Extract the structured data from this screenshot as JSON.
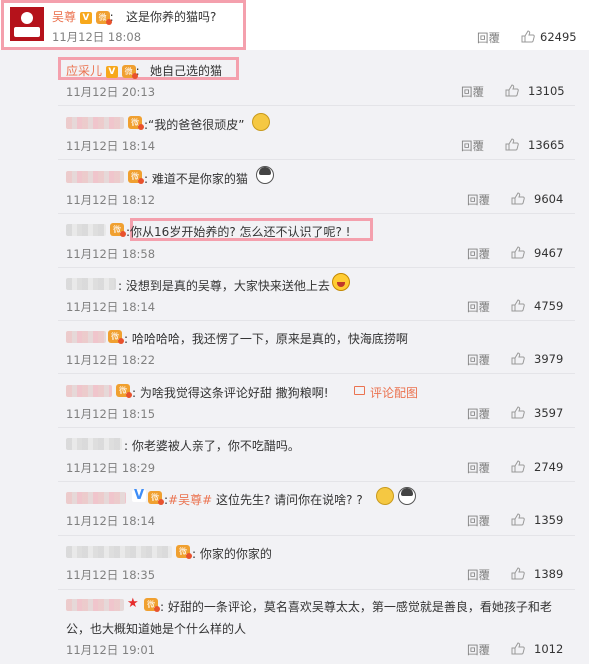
{
  "main_comment": {
    "author": "吴尊",
    "text": "这是你养的猫吗?",
    "time": "11月12日 18:08",
    "reply": "回覆",
    "likes": "62495"
  },
  "replies": [
    {
      "author": "应采儿",
      "text": "她自己选的猫",
      "time": "11月12日 20:13",
      "reply": "回覆",
      "likes": "13105"
    },
    {
      "text": "“我的爸爸很顽皮”",
      "time": "11月12日 18:14",
      "reply": "回覆",
      "likes": "13665"
    },
    {
      "text": "难道不是你家的猫",
      "time": "11月12日 18:12",
      "reply": "回覆",
      "likes": "9604"
    },
    {
      "text": "你从16岁开始养的? 怎么还不认识了呢? !",
      "time": "11月12日 18:58",
      "reply": "回覆",
      "likes": "9467"
    },
    {
      "text": "没想到是真的吴尊，大家快来送他上去",
      "time": "11月12日 18:14",
      "reply": "回覆",
      "likes": "4759"
    },
    {
      "text": "哈哈哈哈，我还愣了一下，原来是真的，快海底捞啊",
      "time": "11月12日 18:22",
      "reply": "回覆",
      "likes": "3979"
    },
    {
      "text": "为啥我觉得这条评论好甜  撒狗粮啊!",
      "link": "评论配图",
      "time": "11月12日 18:15",
      "reply": "回覆",
      "likes": "3597"
    },
    {
      "text": "你老婆被人亲了，你不吃醋吗。",
      "time": "11月12日 18:29",
      "reply": "回覆",
      "likes": "2749"
    },
    {
      "topic": "#吴尊#",
      "text": " 这位先生? 请问你在说啥? ?",
      "time": "11月12日 18:14",
      "reply": "回覆",
      "likes": "1359"
    },
    {
      "text": "你家的你家的",
      "time": "11月12日 18:35",
      "reply": "回覆",
      "likes": "1389"
    },
    {
      "text": "好甜的一条评论，莫名喜欢吴尊太太，第一感觉就是善良，看她孩子和老",
      "text2": "公，也大概知道她是个什么样的人",
      "time": "11月12日 19:01",
      "reply": "回覆",
      "likes": "1012"
    }
  ],
  "badges": {
    "verified": "V",
    "medal": "微"
  },
  "colors": {
    "nickname": "#eb7350",
    "highlight": "#f4a0ad",
    "background": "#f2f2f5",
    "verified_blue": "#3e8df7"
  },
  "icons": [
    "avatar",
    "verified-badge",
    "medal-icon",
    "thumb-up-icon",
    "cat-emoji",
    "husky-emoji",
    "laugh-emoji",
    "picture-icon"
  ]
}
